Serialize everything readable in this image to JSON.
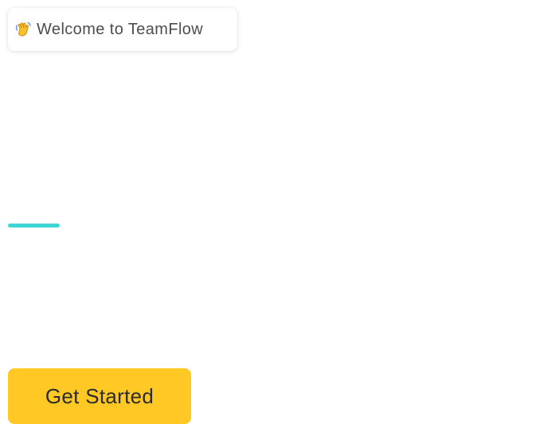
{
  "welcome": {
    "icon": "waving-hand-icon",
    "text": "Welcome to TeamFlow"
  },
  "accent": {
    "color": "#3fd6d3"
  },
  "cta": {
    "label": "Get Started",
    "color": "#ffc824"
  }
}
